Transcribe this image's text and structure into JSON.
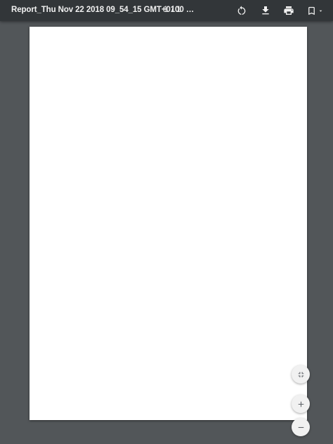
{
  "toolbar": {
    "title": "Report_Thu Nov 22 2018 09_54_15 GMT+0100 …",
    "current_page": "1",
    "page_separator": "/",
    "total_pages": "1",
    "icons": [
      "rotate-icon",
      "download-icon",
      "print-icon",
      "bookmark-icon"
    ]
  },
  "zoom_controls": {
    "icons": [
      "fit-page-icon",
      "zoom-in-icon",
      "zoom-out-icon"
    ]
  },
  "colors": {
    "toolbar_bg": "#323639",
    "viewer_bg": "#525659",
    "page_bg": "#ffffff"
  }
}
